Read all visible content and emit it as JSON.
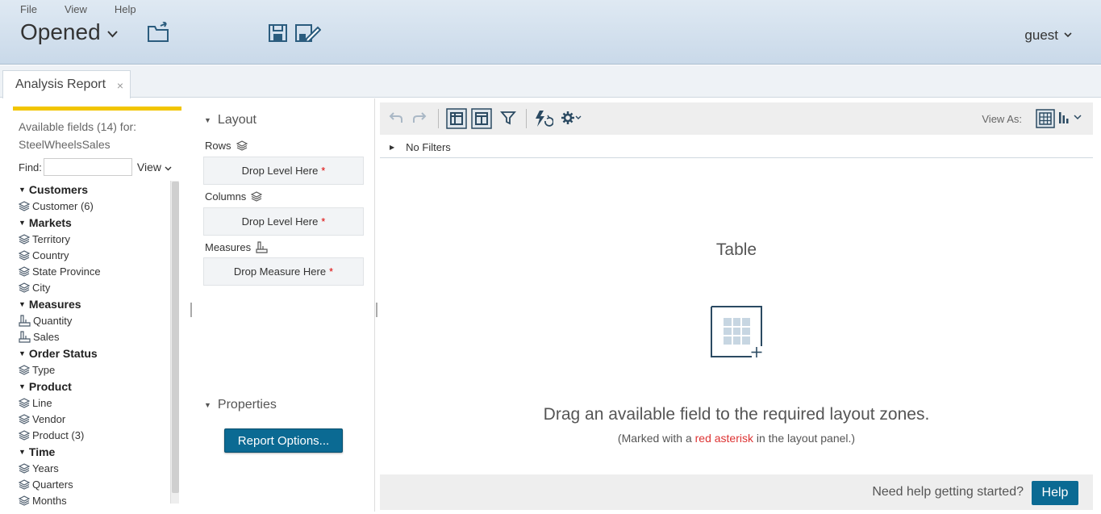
{
  "header": {
    "menu": [
      "File",
      "View",
      "Help"
    ],
    "opened_label": "Opened",
    "user_label": "guest"
  },
  "tab": {
    "label": "Analysis Report",
    "close": "×"
  },
  "fields": {
    "available_label": "Available fields (14) for:",
    "model": "SteelWheelsSales",
    "find_label": "Find:",
    "find_value": "",
    "view_label": "View",
    "groups": [
      {
        "name": "Customers",
        "items": [
          {
            "label": "Customer (6)",
            "kind": "level"
          }
        ]
      },
      {
        "name": "Markets",
        "items": [
          {
            "label": "Territory",
            "kind": "level"
          },
          {
            "label": "Country",
            "kind": "level"
          },
          {
            "label": "State Province",
            "kind": "level"
          },
          {
            "label": "City",
            "kind": "level"
          }
        ]
      },
      {
        "name": "Measures",
        "items": [
          {
            "label": "Quantity",
            "kind": "measure"
          },
          {
            "label": "Sales",
            "kind": "measure"
          }
        ]
      },
      {
        "name": "Order Status",
        "items": [
          {
            "label": "Type",
            "kind": "level"
          }
        ]
      },
      {
        "name": "Product",
        "items": [
          {
            "label": "Line",
            "kind": "level"
          },
          {
            "label": "Vendor",
            "kind": "level"
          },
          {
            "label": "Product (3)",
            "kind": "level"
          }
        ]
      },
      {
        "name": "Time",
        "items": [
          {
            "label": "Years",
            "kind": "level"
          },
          {
            "label": "Quarters",
            "kind": "level"
          },
          {
            "label": "Months",
            "kind": "level"
          }
        ]
      }
    ]
  },
  "layout": {
    "title": "Layout",
    "rows_label": "Rows",
    "rows_drop": "Drop Level Here",
    "columns_label": "Columns",
    "columns_drop": "Drop Level Here",
    "measures_label": "Measures",
    "measures_drop": "Drop Measure Here",
    "asterisk": "*",
    "properties_title": "Properties",
    "report_options": "Report Options..."
  },
  "canvas": {
    "view_as_label": "View As:",
    "filters_label": "No Filters",
    "empty_title": "Table",
    "empty_msg": "Drag an available field to the required layout zones.",
    "empty_sub_pre": "(Marked with a ",
    "empty_sub_red": "red asterisk",
    "empty_sub_post": " in the layout panel.)",
    "help_question": "Need help getting started?",
    "help_button": "Help"
  },
  "colors": {
    "accent_yellow": "#f2c500",
    "primary_button": "#0b6a93",
    "asterisk_red": "#d00"
  }
}
